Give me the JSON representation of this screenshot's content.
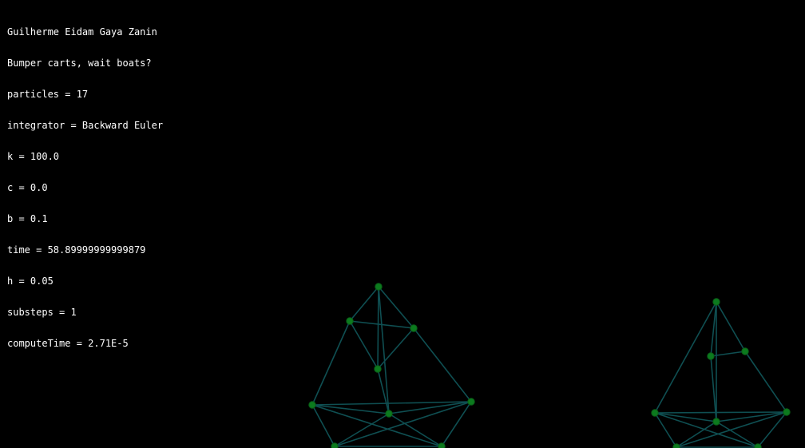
{
  "hud": {
    "author": "Guilherme Eidam Gaya Zanin",
    "subtitle": "Bumper carts, wait boats?",
    "particles": "particles = 17",
    "integrator": "integrator = Backward Euler",
    "k": "k = 100.0",
    "c": "c = 0.0",
    "b": "b = 0.1",
    "time": "time = 58.89999999999879",
    "h": "h = 0.05",
    "substeps": "substeps = 1",
    "computeTime": "computeTime = 2.71E-5"
  },
  "colors": {
    "background": "#000000",
    "text": "#ffffff",
    "spring": "#0f4f52",
    "particle": "#0c7a1e",
    "particle_edge": "#0a5e17"
  }
}
